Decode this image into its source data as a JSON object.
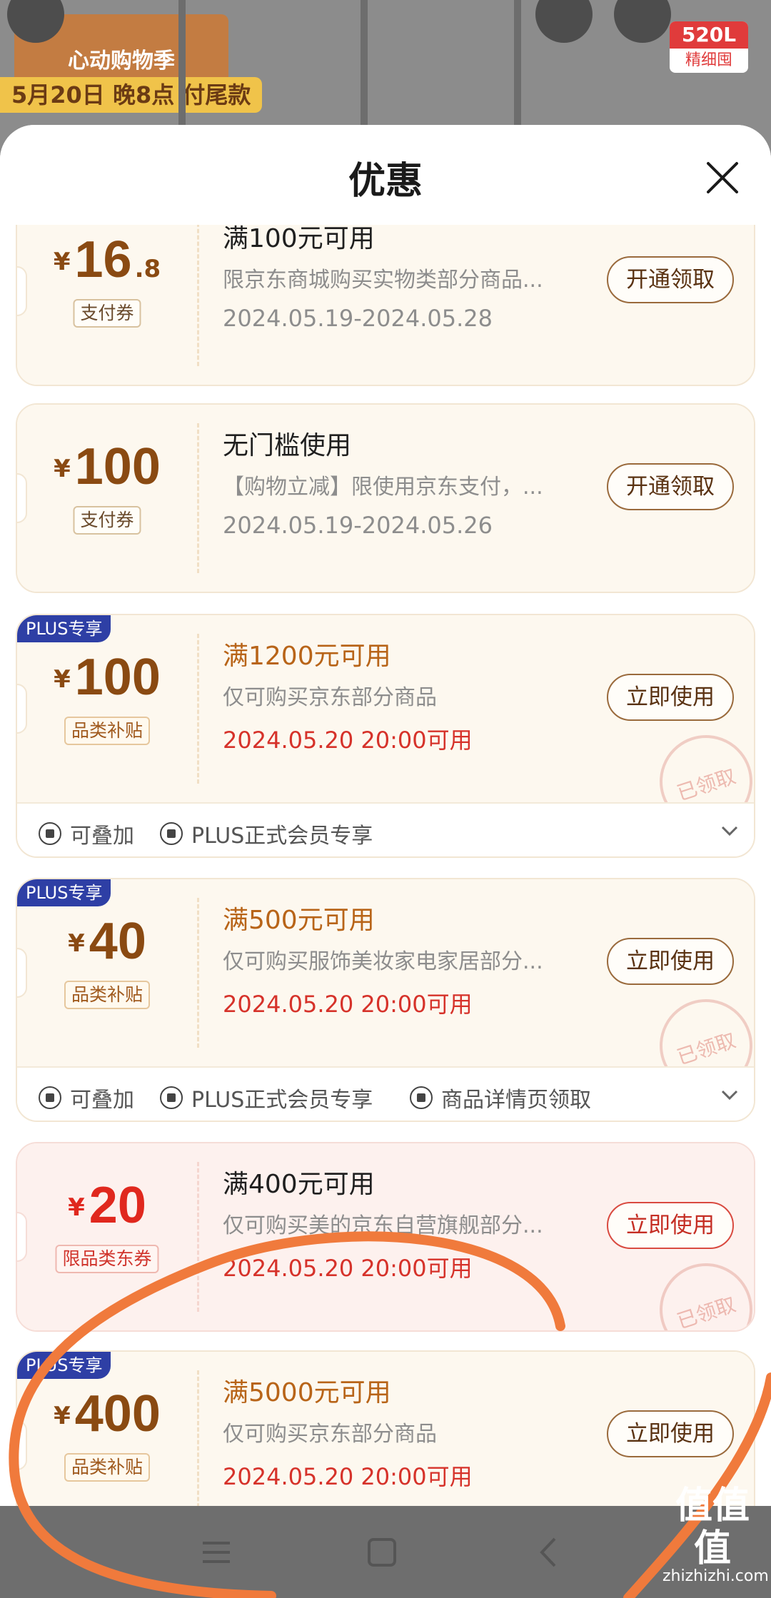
{
  "background": {
    "event_label": "心动购物季",
    "date_label": "5月20日 晚8点 付尾款",
    "capacity": "520L",
    "capacity_sub": "精细囤"
  },
  "sheet": {
    "title": "优惠",
    "close_icon": "close-icon"
  },
  "coupons": [
    {
      "style": "plain",
      "amount_int": "16",
      "amount_dec": ".8",
      "tag": "支付券",
      "condition": "满100元可用",
      "description": "限京东商城购买实物类部分商品...",
      "date": "2024.05.19-2024.05.28",
      "button": "开通领取"
    },
    {
      "style": "plain",
      "amount_int": "100",
      "amount_dec": "",
      "tag": "支付券",
      "condition": "无门槛使用",
      "description": "【购物立减】限使用京东支付，...",
      "date": "2024.05.19-2024.05.26",
      "button": "开通领取"
    },
    {
      "style": "plus",
      "badge": "PLUS专享",
      "amount_int": "100",
      "tag": "品类补贴",
      "condition": "满1200元可用",
      "description": "仅可购买京东部分商品",
      "date": "2024.05.20 20:00可用",
      "button": "立即使用",
      "stamp": "已领取",
      "features": [
        "可叠加",
        "PLUS正式会员专享"
      ]
    },
    {
      "style": "plus",
      "badge": "PLUS专享",
      "amount_int": "40",
      "tag": "品类补贴",
      "condition": "满500元可用",
      "description": "仅可购买服饰美妆家电家居部分...",
      "date": "2024.05.20 20:00可用",
      "button": "立即使用",
      "stamp": "已领取",
      "features": [
        "可叠加",
        "PLUS正式会员专享",
        "商品详情页领取"
      ]
    },
    {
      "style": "red",
      "amount_int": "20",
      "tag": "限品类东券",
      "condition": "满400元可用",
      "description": "仅可购买美的京东自营旗舰部分...",
      "date": "2024.05.20 20:00可用",
      "button": "立即使用",
      "stamp": "已领取"
    },
    {
      "style": "plus",
      "badge": "PLUS专享",
      "amount_int": "400",
      "tag": "品类补贴",
      "condition": "满5000元可用",
      "description": "仅可购买京东部分商品",
      "date": "2024.05.20 20:00可用",
      "button": "立即使用"
    }
  ],
  "navbar": {
    "icons": [
      "menu-icon",
      "home-icon",
      "back-icon"
    ]
  },
  "watermark": {
    "text": "值值值",
    "sub": "zhizhizhi.com"
  },
  "colors": {
    "amount_brown": "#8a4a12",
    "amount_red": "#e0281e",
    "plus_badge": "#2e3fa5",
    "date_red": "#d6322a",
    "condition_orange": "#b86418",
    "scribble": "#f07a3c"
  }
}
